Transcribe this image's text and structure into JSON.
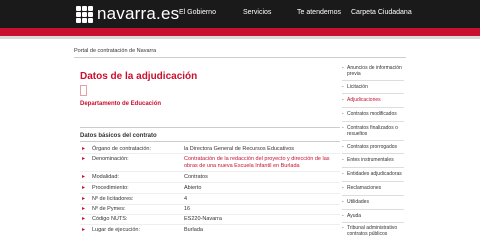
{
  "header": {
    "logo_text": "navarra.es",
    "nav": [
      "El Gobierno",
      "Servicios",
      "Te atendemos",
      "Carpeta Ciudadana"
    ]
  },
  "breadcrumb": "Portal de contratación de Navarra",
  "page": {
    "title": "Datos de la adjudicación",
    "department": "Departamento de Educación"
  },
  "section": {
    "title": "Datos básicos del contrato",
    "rows": [
      {
        "label": "Órgano de contratación:",
        "value": "la Directora General de Recursos Educativos"
      },
      {
        "label": "Denominación:",
        "value": "Contratación de la redacción del proyecto y dirección de las obras de una nueva Escuela Infantil en Burlada"
      },
      {
        "label": "Modalidad:",
        "value": "Contratos"
      },
      {
        "label": "Procedimiento:",
        "value": "Abierto"
      },
      {
        "label": "Nº de licitadores:",
        "value": "4"
      },
      {
        "label": "Nº de Pymes:",
        "value": "16"
      },
      {
        "label": "Código NUTS:",
        "value": "ES220-Navarra"
      },
      {
        "label": "Lugar de ejecución:",
        "value": "Burlada"
      }
    ]
  },
  "sidebar": {
    "active_index": 2,
    "items": [
      "Anuncios de información previa",
      "Licitación",
      "Adjudicaciones",
      "Contratos modificados",
      "Contratos finalizados o resueltos",
      "Contratos prorrogados",
      "Entes instrumentales",
      "Entidades adjudicadoras",
      "Reclamaciones",
      "Utilidades",
      "Ayuda",
      "Tribunal administrativo contratos públicos"
    ]
  },
  "colors": {
    "brand_red": "#c8102e",
    "header_bg": "#1a1a1a"
  }
}
